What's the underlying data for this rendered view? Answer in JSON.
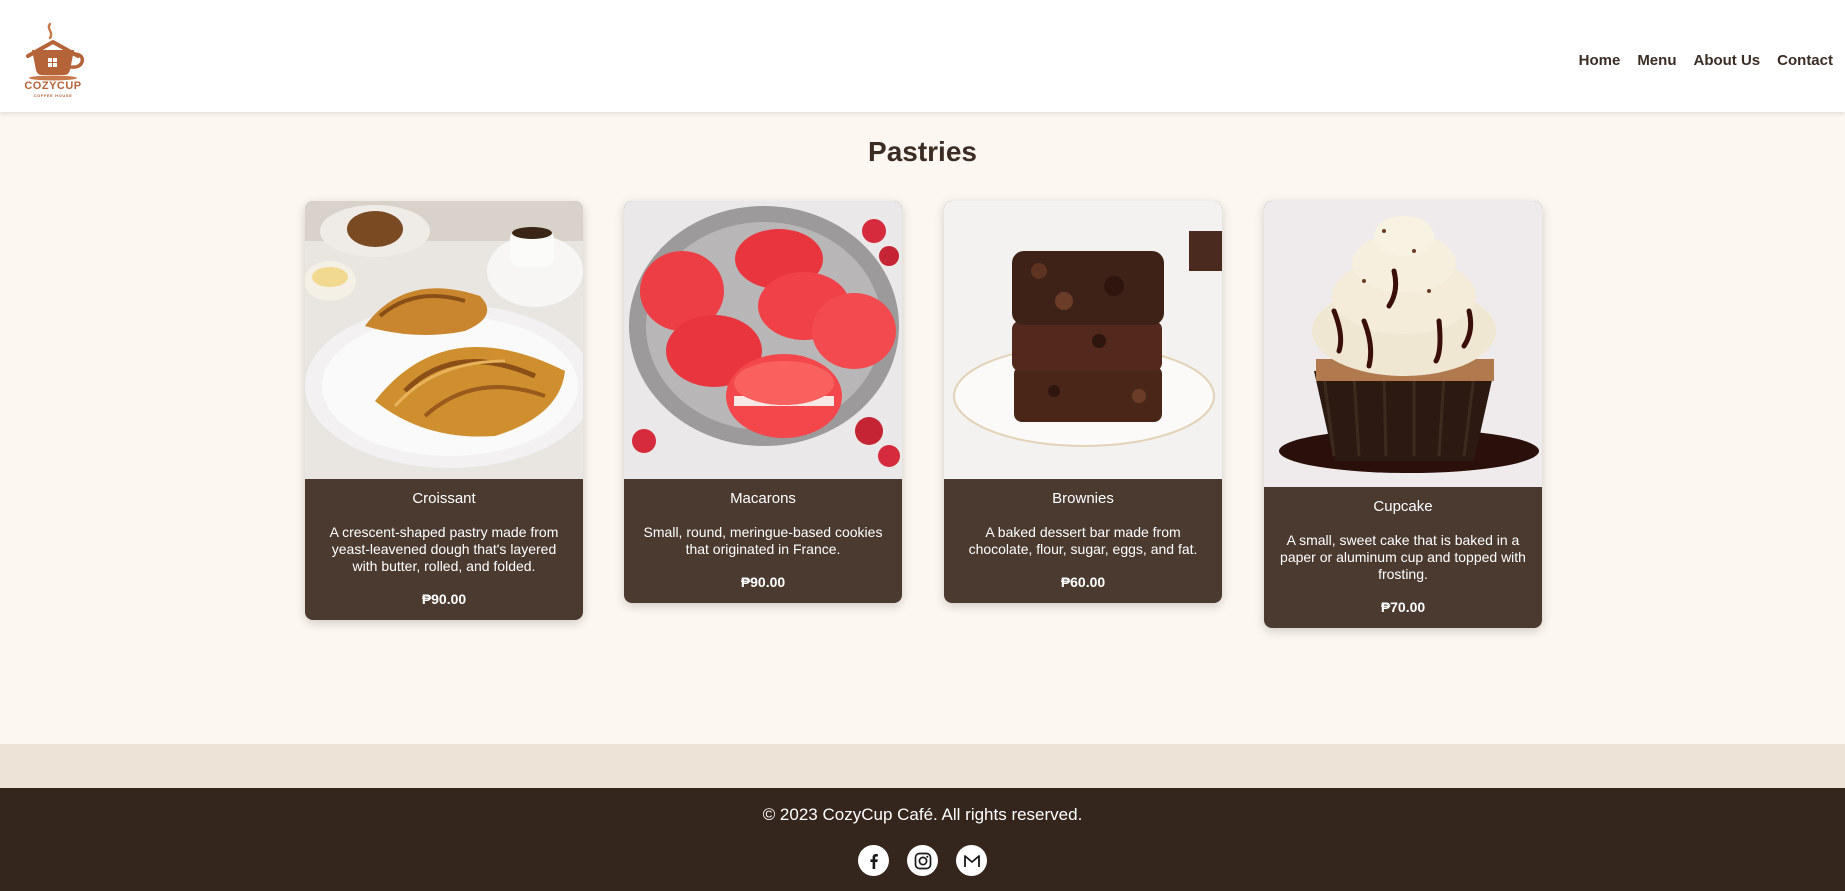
{
  "brand": {
    "name": "COZYCUP",
    "tagline": "COFFEE HOUSE"
  },
  "nav": {
    "items": [
      {
        "label": "Home"
      },
      {
        "label": "Menu"
      },
      {
        "label": "About Us"
      },
      {
        "label": "Contact"
      }
    ]
  },
  "main": {
    "title": "Pastries",
    "products": [
      {
        "name": "Croissant",
        "description": "A crescent-shaped pastry made from yeast-leavened dough that's layered with butter, rolled, and folded.",
        "price": "₱90.00"
      },
      {
        "name": "Macarons",
        "description": "Small, round, meringue-based cookies that originated in France.",
        "price": "₱90.00"
      },
      {
        "name": "Brownies",
        "description": "A baked dessert bar made from chocolate, flour, sugar, eggs, and fat.",
        "price": "₱60.00"
      },
      {
        "name": "Cupcake",
        "description": "A small, sweet cake that is baked in a paper or aluminum cup and topped with frosting.",
        "price": "₱70.00"
      }
    ]
  },
  "footer": {
    "copyright": "© 2023 CozyCup Café. All rights reserved.",
    "socials": [
      {
        "icon": "facebook-icon"
      },
      {
        "icon": "instagram-icon"
      },
      {
        "icon": "gmail-icon"
      }
    ]
  },
  "colors": {
    "header_bg": "#ffffff",
    "page_bg": "#fcf7f0",
    "card_bg": "#4a3a30",
    "band_bg": "#ede3d6",
    "footer_bg": "#35261d",
    "text_dark": "#3b2c24",
    "brand_accent": "#b5643a"
  }
}
